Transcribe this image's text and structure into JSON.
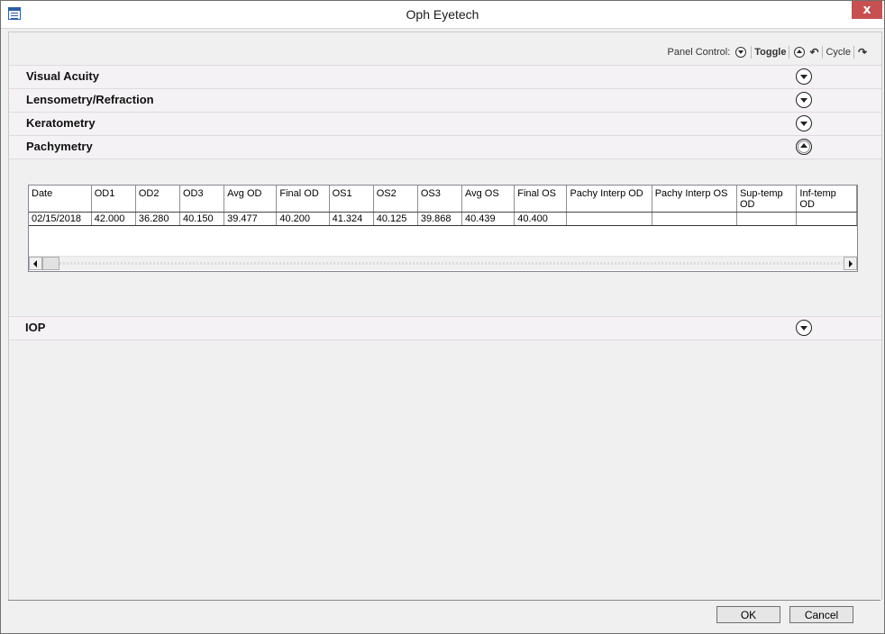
{
  "window": {
    "title": "Oph Eyetech",
    "close_label": "x"
  },
  "panel_control": {
    "label": "Panel Control:",
    "toggle_label": "Toggle",
    "cycle_label": "Cycle"
  },
  "sections": [
    {
      "title": "Visual Acuity",
      "expanded": false
    },
    {
      "title": "Lensometry/Refraction",
      "expanded": false
    },
    {
      "title": "Keratometry",
      "expanded": false
    },
    {
      "title": "Pachymetry",
      "expanded": true
    },
    {
      "title": "IOP",
      "expanded": false
    }
  ],
  "pachymetry_grid": {
    "columns": [
      "Date",
      "OD1",
      "OD2",
      "OD3",
      "Avg OD",
      "Final OD",
      "OS1",
      "OS2",
      "OS3",
      "Avg OS",
      "Final OS",
      "Pachy Interp OD",
      "Pachy Interp OS",
      "Sup-temp OD",
      "Inf-temp OD"
    ],
    "rows": [
      [
        "02/15/2018",
        "42.000",
        "36.280",
        "40.150",
        "39.477",
        "40.200",
        "41.324",
        "40.125",
        "39.868",
        "40.439",
        "40.400",
        "",
        "",
        "",
        ""
      ]
    ]
  },
  "footer": {
    "ok_label": "OK",
    "cancel_label": "Cancel"
  }
}
